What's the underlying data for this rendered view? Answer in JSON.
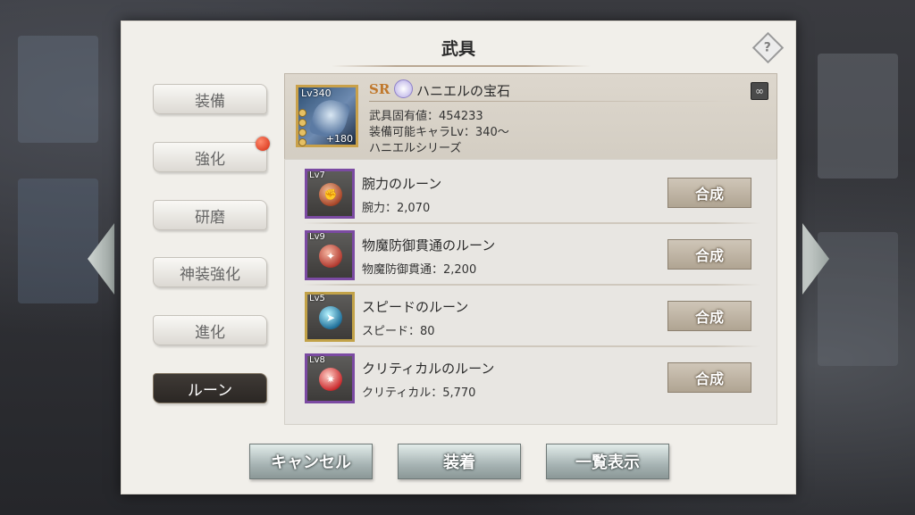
{
  "window": {
    "title": "武具"
  },
  "side_menu": {
    "items": [
      {
        "label": "装備",
        "active": false,
        "badge": false
      },
      {
        "label": "強化",
        "active": false,
        "badge": true
      },
      {
        "label": "研磨",
        "active": false,
        "badge": false
      },
      {
        "label": "神装強化",
        "active": false,
        "badge": false
      },
      {
        "label": "進化",
        "active": false,
        "badge": false
      },
      {
        "label": "ルーン",
        "active": true,
        "badge": false
      }
    ]
  },
  "item": {
    "level": "Lv340",
    "plus": "+180",
    "rarity": "SR",
    "name": "ハニエルの宝石",
    "base_value": "武具固有値：454233",
    "equip_level": "装備可能キャラLv：340～",
    "series": "ハニエルシリーズ"
  },
  "runes": [
    {
      "level": "Lv7",
      "name": "腕力のルーン",
      "stat": "腕力：2,070",
      "button": "合成",
      "gem": "gem-power",
      "frame": "purple",
      "icon": "fist-icon"
    },
    {
      "level": "Lv9",
      "name": "物魔防御貫通のルーン",
      "stat": "物魔防御貫通：2,200",
      "button": "合成",
      "gem": "gem-pierce",
      "frame": "purple",
      "icon": "pierce-icon"
    },
    {
      "level": "Lv5",
      "name": "スピードのルーン",
      "stat": "スピード：80",
      "button": "合成",
      "gem": "gem-speed",
      "frame": "gold",
      "icon": "speed-icon"
    },
    {
      "level": "Lv8",
      "name": "クリティカルのルーン",
      "stat": "クリティカル：5,770",
      "button": "合成",
      "gem": "gem-crit",
      "frame": "purple",
      "icon": "critical-icon"
    }
  ],
  "footer": {
    "cancel_label": "キャンセル",
    "equip_label": "装着",
    "list_label": "一覧表示"
  },
  "colors": {
    "panel": "#f1efea",
    "rarity": "#c0782c",
    "rune_frame_purple": "#7b4aa2",
    "rune_frame_gold": "#c2a248",
    "badge_red": "#d42a10"
  },
  "icons": {
    "help": "help-diamond-icon",
    "series": "series-link-icon",
    "prev": "arrow-left-icon",
    "next": "arrow-right-icon"
  }
}
